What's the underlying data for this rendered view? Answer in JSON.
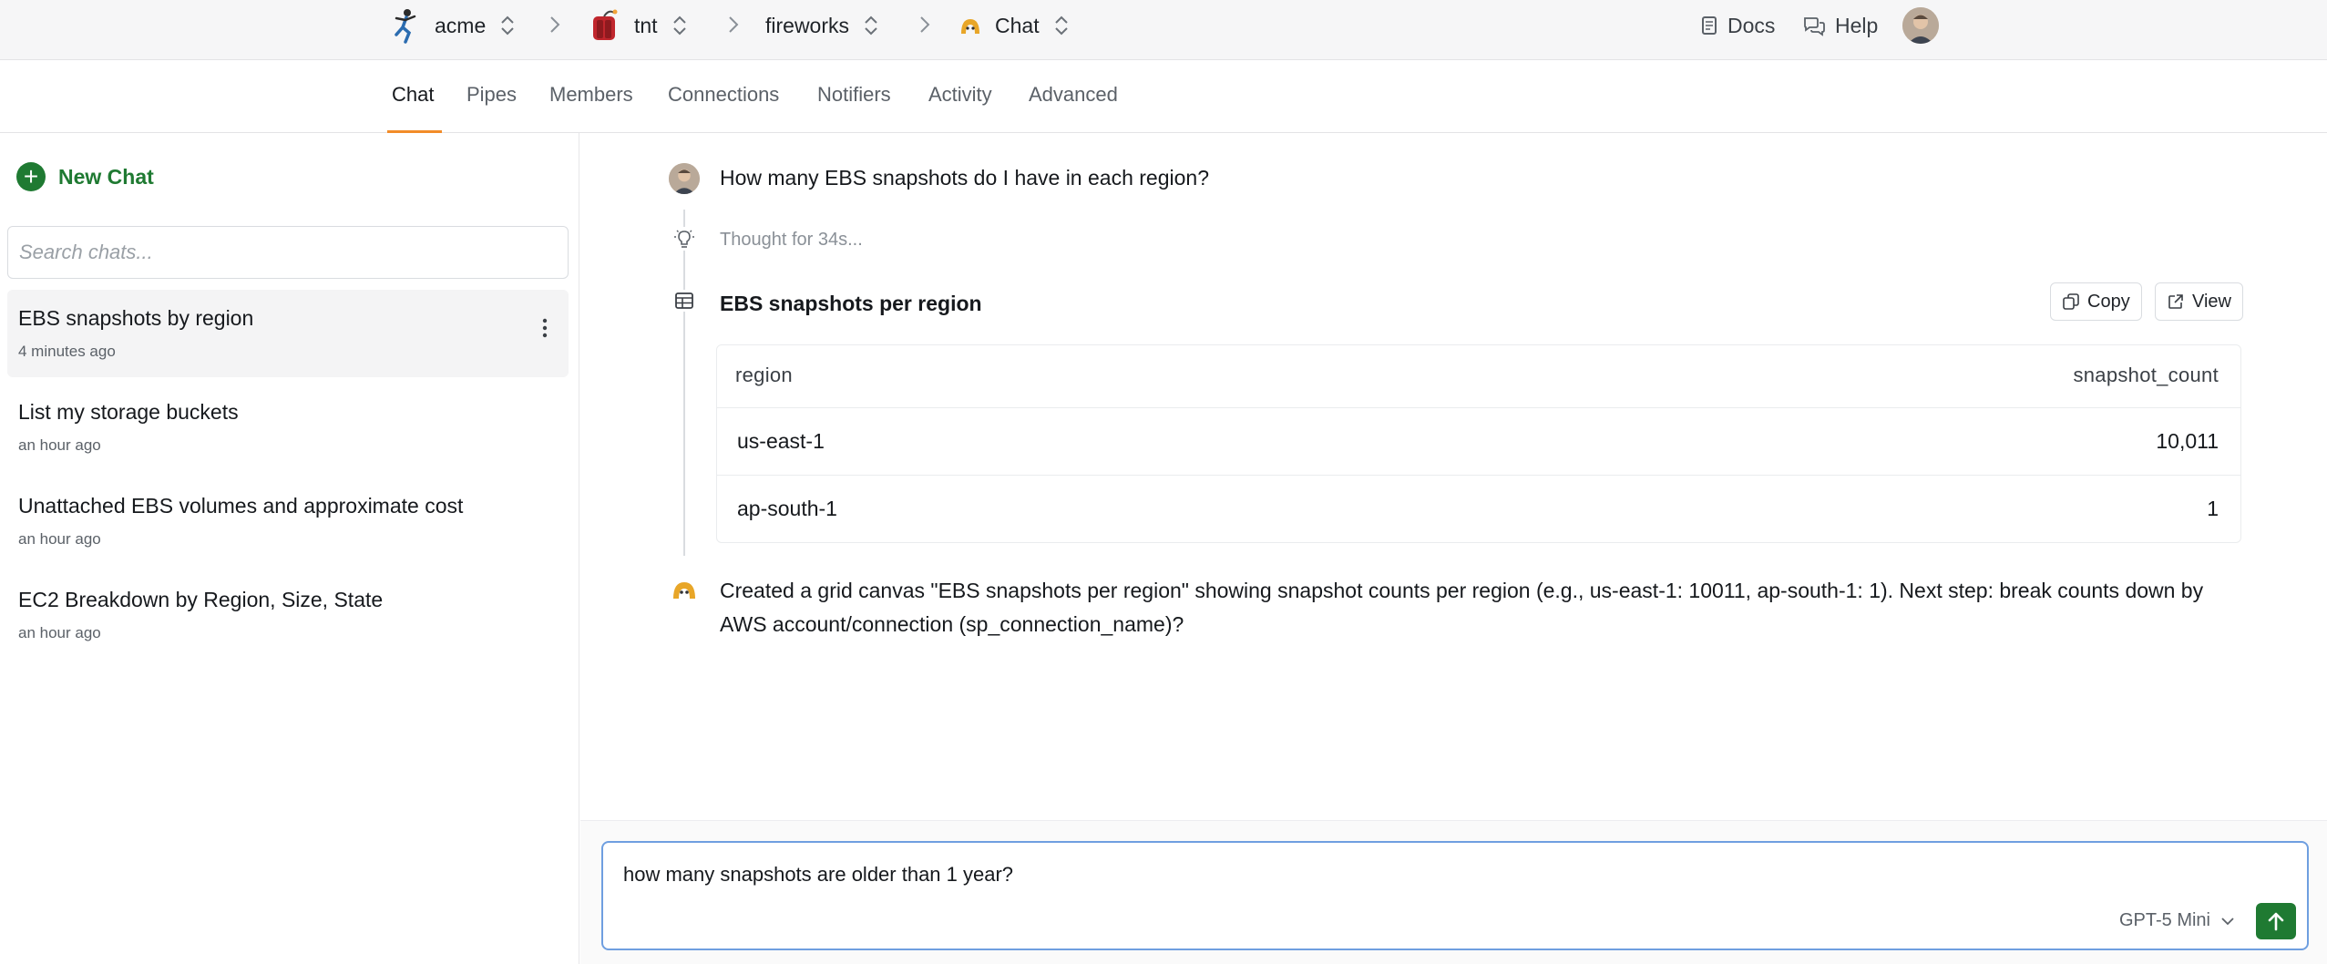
{
  "header": {
    "breadcrumbs": [
      {
        "label": "acme",
        "icon": "runner-logo-icon"
      },
      {
        "label": "tnt",
        "icon": "tnt-logo-icon"
      },
      {
        "label": "fireworks",
        "icon": ""
      },
      {
        "label": "Chat",
        "icon": "chat-logo-icon"
      }
    ],
    "docs_label": "Docs",
    "help_label": "Help"
  },
  "tabs": [
    {
      "label": "Chat",
      "active": true
    },
    {
      "label": "Pipes",
      "active": false
    },
    {
      "label": "Members",
      "active": false
    },
    {
      "label": "Connections",
      "active": false
    },
    {
      "label": "Notifiers",
      "active": false
    },
    {
      "label": "Activity",
      "active": false
    },
    {
      "label": "Advanced",
      "active": false
    }
  ],
  "sidebar": {
    "new_chat_label": "New Chat",
    "search_placeholder": "Search chats...",
    "chats": [
      {
        "title": "EBS snapshots by region",
        "time": "4 minutes ago",
        "selected": true
      },
      {
        "title": "List my storage buckets",
        "time": "an hour ago",
        "selected": false
      },
      {
        "title": "Unattached EBS volumes and approximate cost",
        "time": "an hour ago",
        "selected": false
      },
      {
        "title": "EC2 Breakdown by Region, Size, State",
        "time": "an hour ago",
        "selected": false
      }
    ]
  },
  "conversation": {
    "user_message": "How many EBS snapshots do I have in each region?",
    "thought": "Thought for 34s...",
    "canvas": {
      "title": "EBS snapshots per region",
      "copy_label": "Copy",
      "view_label": "View",
      "columns": [
        "region",
        "snapshot_count"
      ],
      "rows": [
        {
          "region": "us-east-1",
          "snapshot_count": "10,011"
        },
        {
          "region": "ap-south-1",
          "snapshot_count": "1"
        }
      ]
    },
    "assistant_message": "Created a grid canvas \"EBS snapshots per region\" showing snapshot counts per region (e.g., us-east-1: 10011, ap-south-1: 1). Next step: break counts down by AWS account/connection (sp_connection_name)?"
  },
  "composer": {
    "value": "how many snapshots are older than 1 year?",
    "model": "GPT-5 Mini"
  },
  "colors": {
    "accent_green": "#1f7a32",
    "tab_underline": "#f28c28",
    "composer_border": "#6f9fe0"
  }
}
